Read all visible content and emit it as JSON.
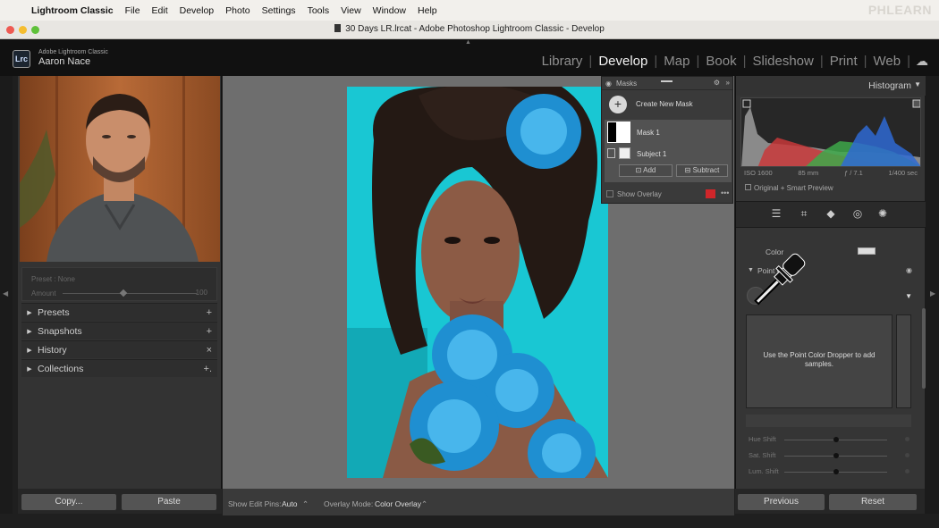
{
  "menubar": {
    "app": "Lightroom Classic",
    "items": [
      "File",
      "Edit",
      "Develop",
      "Photo",
      "Settings",
      "Tools",
      "View",
      "Window",
      "Help"
    ],
    "watermark": "PHLEARN"
  },
  "window": {
    "title": "30 Days LR.lrcat - Adobe Photoshop Lightroom Classic - Develop"
  },
  "lr_header": {
    "logo": "Lrc",
    "product": "Adobe Lightroom Classic",
    "user": "Aaron Nace",
    "modules": [
      "Library",
      "Develop",
      "Map",
      "Book",
      "Slideshow",
      "Print",
      "Web"
    ],
    "active_module": "Develop"
  },
  "left_panel": {
    "preset_label": "Preset",
    "preset_value": "None",
    "amount_label": "Amount",
    "amount_value": "100",
    "sections": [
      {
        "label": "Presets",
        "action": "+"
      },
      {
        "label": "Snapshots",
        "action": "+"
      },
      {
        "label": "History",
        "action": "×"
      },
      {
        "label": "Collections",
        "action": "+."
      }
    ],
    "copy_label": "Copy...",
    "paste_label": "Paste"
  },
  "toolbar": {
    "edit_pins_label": "Show Edit Pins:",
    "edit_pins_value": "Auto",
    "overlay_mode_label": "Overlay Mode:",
    "overlay_mode_value": "Color Overlay"
  },
  "masks_panel": {
    "title": "Masks",
    "create_label": "Create New Mask",
    "mask_name": "Mask 1",
    "component_name": "Subject 1",
    "add_label": "Add",
    "subtract_label": "Subtract",
    "show_overlay_label": "Show Overlay",
    "overlay_color": "#d0262a"
  },
  "right_panel": {
    "histogram_title": "Histogram",
    "iso": "ISO 1600",
    "focal": "85 mm",
    "aperture": "ƒ / 7.1",
    "shutter": "1/400 sec",
    "preview_label": "Original + Smart Preview",
    "color_label": "Color",
    "point_color_label": "Point Co",
    "samples_hint": "Use the Point Color Dropper to add samples.",
    "shifts": [
      "Hue Shift",
      "Sat. Shift",
      "Lum. Shift"
    ],
    "shift_values": [
      0,
      0,
      0
    ],
    "previous_label": "Previous",
    "reset_label": "Reset"
  },
  "colors": {
    "accent_overlay": "#00c8dc",
    "panel_bg": "#333333"
  }
}
